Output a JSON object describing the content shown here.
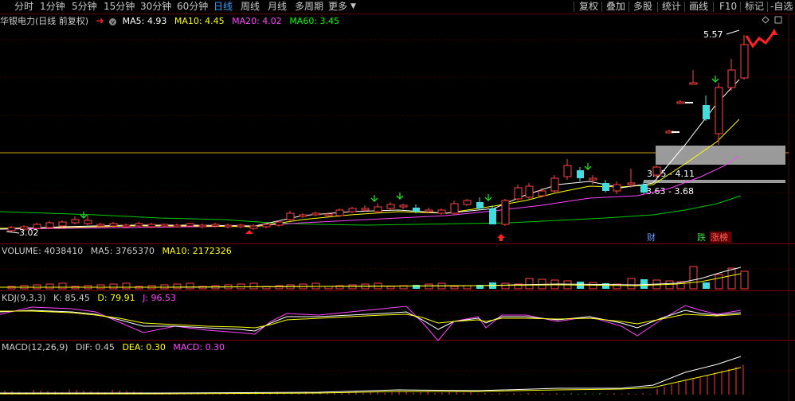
{
  "toolbar": {
    "periods": [
      "分时",
      "1分钟",
      "5分钟",
      "15分钟",
      "30分钟",
      "60分钟",
      "日线",
      "周线",
      "月线",
      "多周期",
      "更多"
    ],
    "active_period": "日线",
    "right_tools": [
      "复权",
      "叠加",
      "多股",
      "统计",
      "画线",
      "F10",
      "标记",
      "-自选"
    ]
  },
  "main_legend": {
    "title": "华银电力(日线 前复权)",
    "ma5": "MA5: 4.93",
    "ma10": "MA10: 4.45",
    "ma20": "MA20: 4.02",
    "ma60": "MA60: 3.45"
  },
  "volume_legend": {
    "name": "VOLUME: 4038410",
    "ma5": "MA5: 3765370",
    "ma10": "MA10: 2172326"
  },
  "kdj_legend": {
    "name": "KDJ(9,3,3)",
    "k": "K: 85.45",
    "d": "D: 79.91",
    "j": "J: 96.53"
  },
  "macd_legend": {
    "name": "MACD(12,26,9)",
    "dif": "DIF: 0.45",
    "dea": "DEA: 0.30",
    "macd": "MACD: 0.30"
  },
  "annotations": {
    "high": "5.57",
    "low": "3.02",
    "zone1": "3.95 - 4.11",
    "zone2": "3.63 - 3.68",
    "badge_cai": "财",
    "badge_die": "跌",
    "badge_zhangbang": "涨榜"
  },
  "colors": {
    "up": "#ff4444",
    "down": "#44dddd",
    "ma5": "#ffffff",
    "ma10": "#ffff00",
    "ma20": "#ff44ff",
    "ma60": "#00ff00",
    "active_tab": "#33a0ff"
  }
}
